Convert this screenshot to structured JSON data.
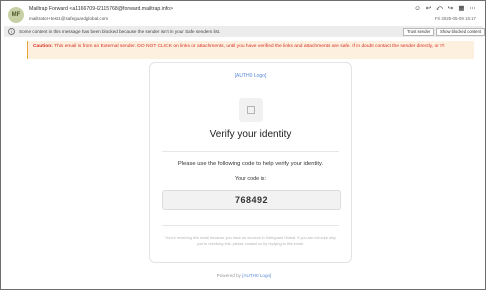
{
  "header": {
    "avatar_initials": "MF",
    "from": "Mailtrap Forward <a1166709-l2115768@forward.mailtrap.info>",
    "to": "mailtrator+test1@safeguardglobal.com",
    "date": "Fri 2025-05-09 16:17",
    "icons": [
      "smile-icon",
      "reply-icon",
      "reply-all-icon",
      "forward-icon",
      "grid-icon",
      "more-icon"
    ]
  },
  "blocked": {
    "message": "Some content in this message has been blocked because the sender isn't in your Safe senders list.",
    "trust_label": "Trust sender",
    "show_label": "Show blocked content"
  },
  "caution": {
    "label": "Caution:",
    "text": " This email is from an External sender. DO NOT CLICK on links or attachments, until you have verified the links and attachments are safe. If in doubt contact the sender directly, or IT."
  },
  "card": {
    "logo_alt": "[AUTH0 Logo]",
    "title": "Verify your identity",
    "lead": "Please use the following code to help verify your identity.",
    "code_label": "Your code is:",
    "code": "768492",
    "fine_print": "You're receiving this email because you have an account in Safeguard Global. If you are not sure why you're receiving this, please contact us by replying to this email."
  },
  "footer": {
    "powered_prefix": "Powered by",
    "powered_link": "[AUTH0 Logo]"
  },
  "colors": {
    "caution_text": "#d93025",
    "caution_bg": "#fdf0df",
    "link": "#5b8bd6",
    "avatar_bg": "#c7d0a4"
  }
}
